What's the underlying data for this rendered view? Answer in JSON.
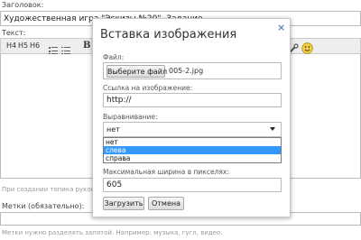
{
  "page": {
    "title_label": "Заголовок:",
    "title_value": "Художественная игра \"Эскизы №20\". Задание",
    "text_label": "Текст:",
    "toolbar": [
      "H4",
      "H5",
      "H6",
      "B"
    ],
    "hint_text": "При создании топика руковод",
    "tags_label": "Метки (обязательно):",
    "tags_hint": "Метки нужно разделять запятой. Например: музыка, гугл, видео."
  },
  "modal": {
    "title": "Вставка изображения",
    "close": "×",
    "file_label": "Файл:",
    "choose_file_label": "Выберите файл",
    "file_name": "005-2.jpg",
    "link_label": "Ссылка на изображение:",
    "link_value": "http://",
    "align_label": "Выравнивание:",
    "align_value": "нет",
    "align_options": [
      "нет",
      "слева",
      "справа"
    ],
    "align_selected_index": 1,
    "maxwidth_label": "Максимальная ширина в пикселях:",
    "maxwidth_value": "605",
    "upload_label": "Загрузить",
    "cancel_label": "Отмена"
  }
}
